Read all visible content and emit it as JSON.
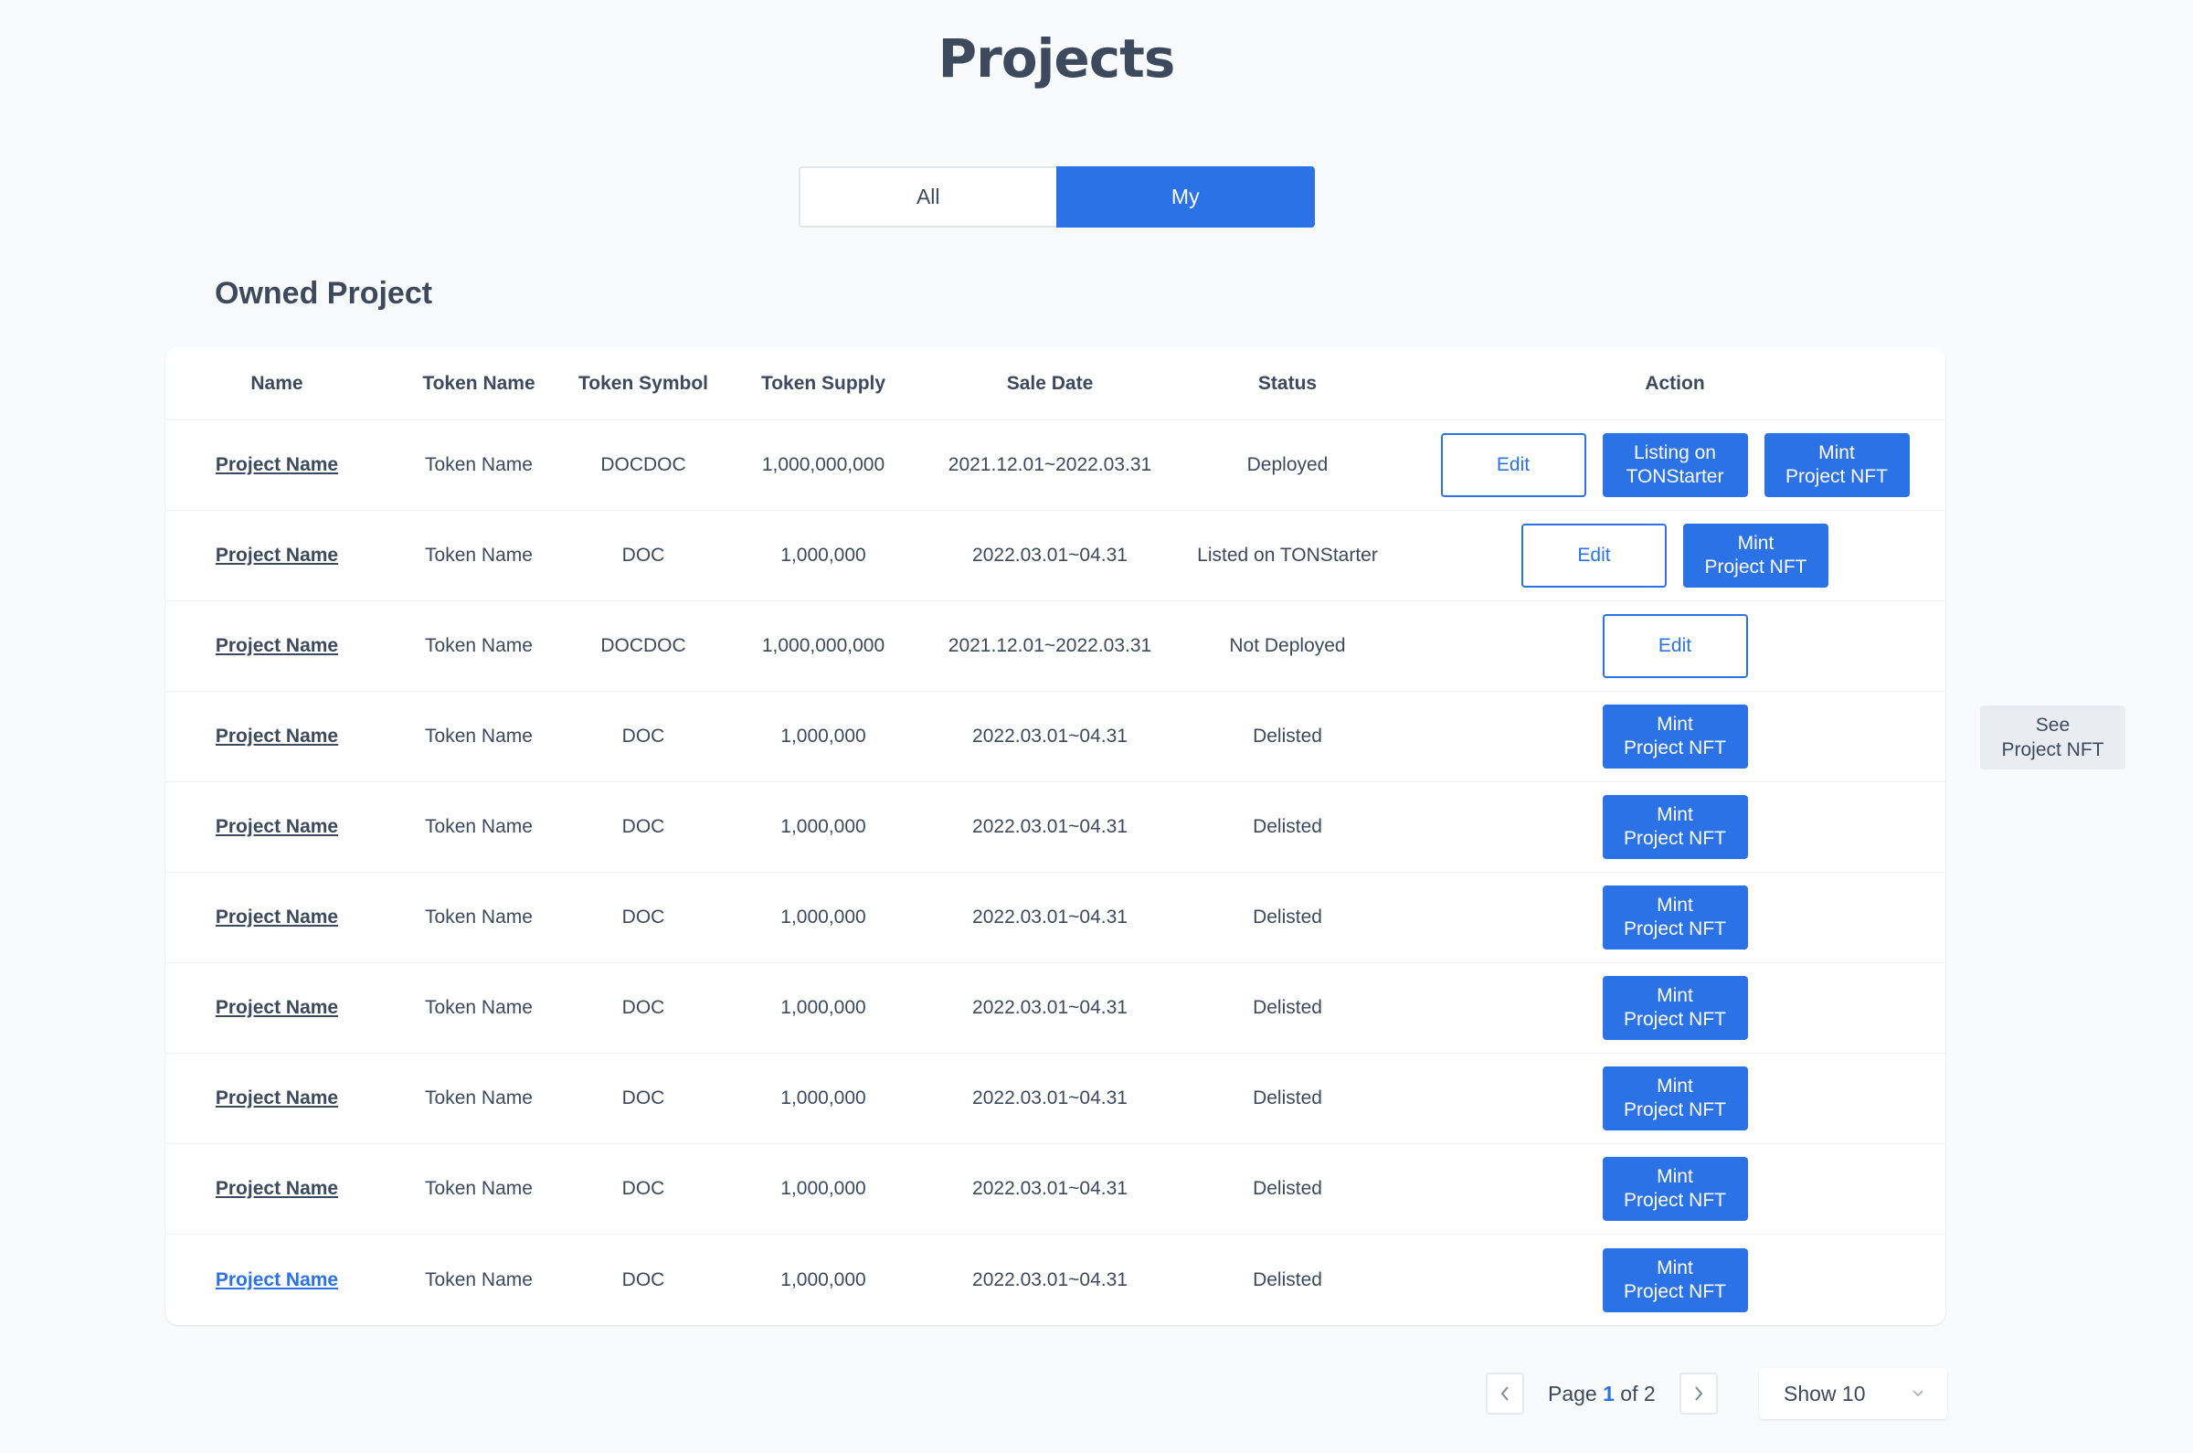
{
  "header": {
    "title": "Projects"
  },
  "tabs": [
    {
      "label": "All"
    },
    {
      "label": "My"
    }
  ],
  "section": {
    "title": "Owned Project"
  },
  "table": {
    "columns": [
      "Name",
      "Token Name",
      "Token Symbol",
      "Token Supply",
      "Sale Date",
      "Status",
      "Action"
    ],
    "rows": [
      {
        "name": "Project Name",
        "token_name": "Token Name",
        "symbol": "DOCDOC",
        "supply": "1,000,000,000",
        "sale_date": "2021.12.01~2022.03.31",
        "status": "Deployed",
        "actions": [
          "Edit",
          "Listing on\nTONStarter",
          "Mint\nProject NFT"
        ]
      },
      {
        "name": "Project Name",
        "token_name": "Token Name",
        "symbol": "DOC",
        "supply": "1,000,000",
        "sale_date": "2022.03.01~04.31",
        "status": "Listed on TONStarter",
        "actions": [
          "Edit",
          "Mint\nProject NFT"
        ]
      },
      {
        "name": "Project Name",
        "token_name": "Token Name",
        "symbol": "DOCDOC",
        "supply": "1,000,000,000",
        "sale_date": "2021.12.01~2022.03.31",
        "status": "Not Deployed",
        "actions": [
          "Edit"
        ]
      },
      {
        "name": "Project Name",
        "token_name": "Token Name",
        "symbol": "DOC",
        "supply": "1,000,000",
        "sale_date": "2022.03.01~04.31",
        "status": "Delisted",
        "actions": [
          "Mint\nProject NFT"
        ]
      },
      {
        "name": "Project Name",
        "token_name": "Token Name",
        "symbol": "DOC",
        "supply": "1,000,000",
        "sale_date": "2022.03.01~04.31",
        "status": "Delisted",
        "actions": [
          "Mint\nProject NFT"
        ]
      },
      {
        "name": "Project Name",
        "token_name": "Token Name",
        "symbol": "DOC",
        "supply": "1,000,000",
        "sale_date": "2022.03.01~04.31",
        "status": "Delisted",
        "actions": [
          "Mint\nProject NFT"
        ]
      },
      {
        "name": "Project Name",
        "token_name": "Token Name",
        "symbol": "DOC",
        "supply": "1,000,000",
        "sale_date": "2022.03.01~04.31",
        "status": "Delisted",
        "actions": [
          "Mint\nProject NFT"
        ]
      },
      {
        "name": "Project Name",
        "token_name": "Token Name",
        "symbol": "DOC",
        "supply": "1,000,000",
        "sale_date": "2022.03.01~04.31",
        "status": "Delisted",
        "actions": [
          "Mint\nProject NFT"
        ]
      },
      {
        "name": "Project Name",
        "token_name": "Token Name",
        "symbol": "DOC",
        "supply": "1,000,000",
        "sale_date": "2022.03.01~04.31",
        "status": "Delisted",
        "actions": [
          "Mint\nProject NFT"
        ]
      },
      {
        "name": "Project Name",
        "token_name": "Token Name",
        "symbol": "DOC",
        "supply": "1,000,000",
        "sale_date": "2022.03.01~04.31",
        "status": "Delisted",
        "actions": [
          "Mint\nProject NFT"
        ]
      }
    ]
  },
  "side_button": {
    "label": "See\nProject NFT"
  },
  "pagination": {
    "page_prefix": "Page",
    "current": "1",
    "page_suffix": "of 2"
  },
  "page_size": {
    "label": "Show 10"
  },
  "colors": {
    "accent": "#2a72e5",
    "text": "#3d495d",
    "background": "#f9fafc",
    "hover_link": "#2a72e5"
  },
  "icons": {
    "prev": "chevron-left-icon",
    "next": "chevron-right-icon",
    "dropdown": "chevron-down-icon"
  }
}
